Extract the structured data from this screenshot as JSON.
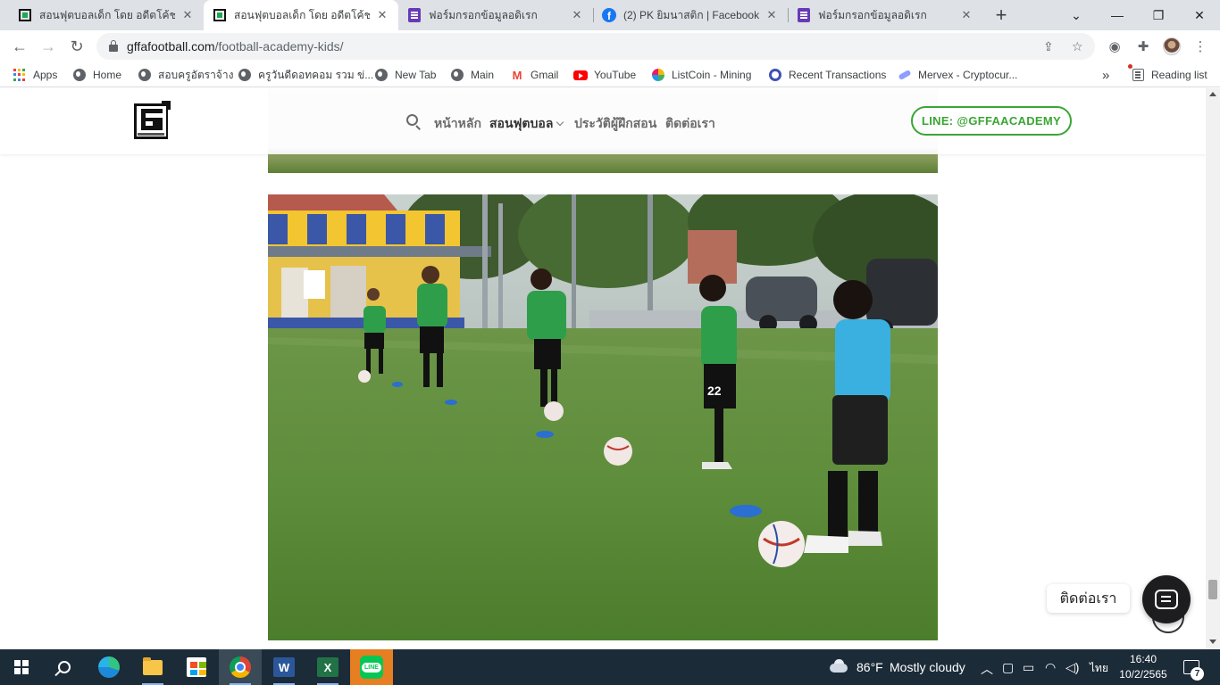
{
  "tabs": [
    {
      "title": "สอนฟุตบอลเด็ก โดย อดีตโค้ชเยาวชน",
      "icon": "gff-icon",
      "active": false
    },
    {
      "title": "สอนฟุตบอลเด็ก โดย อดีตโค้ชเยาวชน",
      "icon": "gff-icon",
      "active": true
    },
    {
      "title": "ฟอร์มกรอกข้อมูลอดิเรก",
      "icon": "google-forms-icon",
      "active": false
    },
    {
      "title": "(2) PK ยิมนาสติก | Facebook",
      "icon": "facebook-icon",
      "active": false
    },
    {
      "title": "ฟอร์มกรอกข้อมูลอดิเรก",
      "icon": "google-forms-icon",
      "active": false
    }
  ],
  "address": {
    "domain": "gffafootball.com",
    "path": "/football-academy-kids/"
  },
  "bookmarks": {
    "items": [
      {
        "label": "Apps",
        "icon": "apps-grid-icon"
      },
      {
        "label": "Home",
        "icon": "globe-icon"
      },
      {
        "label": "สอบครูอัตราจ้าง",
        "icon": "globe-icon"
      },
      {
        "label": "ครูวันดีดอทคอม รวม ข่...",
        "icon": "globe-icon"
      },
      {
        "label": "New Tab",
        "icon": "globe-icon"
      },
      {
        "label": "Main",
        "icon": "globe-icon"
      },
      {
        "label": "Gmail",
        "icon": "gmail-icon"
      },
      {
        "label": "YouTube",
        "icon": "youtube-icon"
      },
      {
        "label": "ListCoin - Mining",
        "icon": "listcoin-icon"
      },
      {
        "label": "Recent Transactions",
        "icon": "recent-transactions-icon"
      },
      {
        "label": "Mervex - Cryptocur...",
        "icon": "mervex-icon"
      }
    ],
    "overflow": "»",
    "reading_list": "Reading list"
  },
  "site": {
    "nav": [
      {
        "label": "หน้าหลัก"
      },
      {
        "label": "สอนฟุตบอล",
        "has_dropdown": true,
        "current": true
      },
      {
        "label": "ประวัติผู้ฝึกสอน"
      },
      {
        "label": "ติดต่อเรา"
      }
    ],
    "cta": "LINE: @GFFAACADEMY",
    "accent_color": "#3aa635",
    "chat_label": "ติดต่อเรา"
  },
  "taskbar": {
    "apps": [
      "start-button",
      "search",
      "edge",
      "file-explorer",
      "microsoft-store",
      "chrome",
      "word",
      "excel",
      "line"
    ],
    "weather": {
      "temp": "86°F",
      "condition": "Mostly cloudy"
    },
    "language": "ไทย",
    "time": "16:40",
    "date": "10/2/2565",
    "notifications": "7"
  }
}
